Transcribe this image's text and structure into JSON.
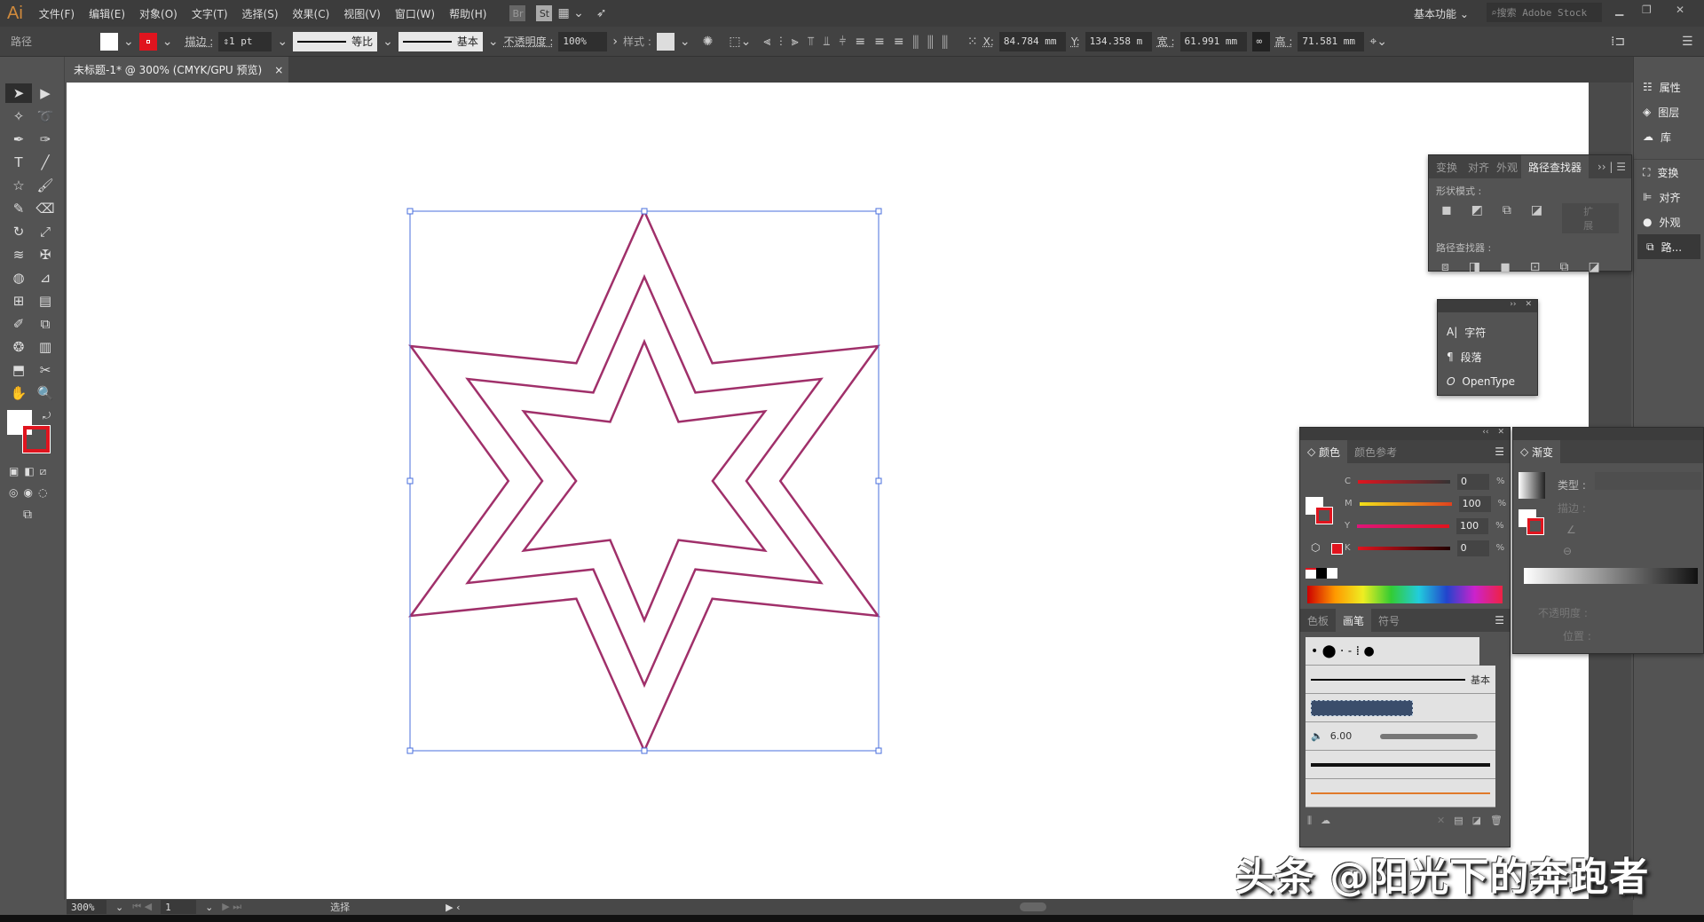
{
  "app": {
    "logo": "Ai"
  },
  "menu": [
    "文件(F)",
    "编辑(E)",
    "对象(O)",
    "文字(T)",
    "选择(S)",
    "效果(C)",
    "视图(V)",
    "窗口(W)",
    "帮助(H)"
  ],
  "bridge": {
    "br": "Br",
    "st": "St"
  },
  "workspace": "基本功能",
  "search_placeholder": "搜索 Adobe Stock",
  "control": {
    "selection_type": "路径",
    "stroke_label": "描边 :",
    "stroke_weight": "1 pt",
    "profile": "等比",
    "brush": "基本",
    "opacity_label": "不透明度 :",
    "opacity": "100%",
    "style_label": "样式 :",
    "x_label": "X:",
    "x": "84.784 mm",
    "y_label": "Y:",
    "y": "134.358 m",
    "w_label": "宽 :",
    "w": "61.991 mm",
    "h_label": "高 :",
    "h": "71.581 mm"
  },
  "document_tab": {
    "title": "未标题-1* @ 300% (CMYK/GPU 预览)",
    "close": "×"
  },
  "colors": {
    "stroke": "#a0306a",
    "selection": "#4a6fdc",
    "accent_red": "#e0141e"
  },
  "dock": [
    "属性",
    "图层",
    "库",
    "变换",
    "对齐",
    "外观",
    "路..."
  ],
  "pathfinder": {
    "tabs": [
      "变换",
      "对齐",
      "外观",
      "路径查找器"
    ],
    "shape_modes": "形状模式 :",
    "expand": "扩展",
    "pathfinders": "路径查找器 :"
  },
  "type_panel": {
    "items": [
      "字符",
      "段落",
      "OpenType"
    ]
  },
  "color_panel": {
    "tabs": [
      "颜色",
      "颜色参考"
    ],
    "channels": [
      {
        "name": "C",
        "value": "0"
      },
      {
        "name": "M",
        "value": "100"
      },
      {
        "name": "Y",
        "value": "100"
      },
      {
        "name": "K",
        "value": "0"
      }
    ],
    "unit": "%"
  },
  "brush_panel": {
    "tabs": [
      "色板",
      "画笔",
      "符号"
    ],
    "basic": "基本",
    "size": "6.00"
  },
  "gradient_panel": {
    "title": "渐变",
    "type_label": "类型 :",
    "stroke_label": "描边 :",
    "opacity_label": "不透明度 :",
    "location_label": "位置 :"
  },
  "status": {
    "zoom": "300%",
    "artboard": "1",
    "tool": "选择"
  },
  "watermark": "头条 @阳光下的奔跑者"
}
